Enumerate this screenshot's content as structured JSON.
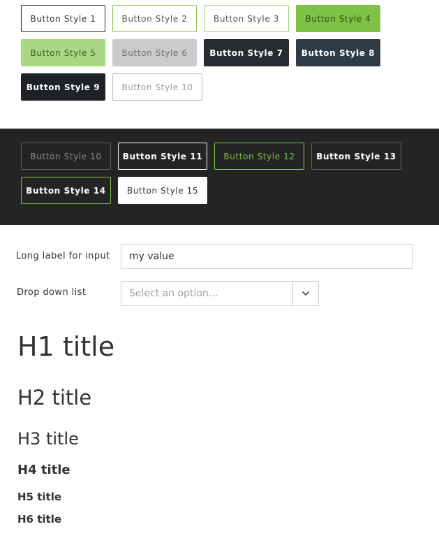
{
  "light_buttons": {
    "b1": "Button Style 1",
    "b2": "Button Style 2",
    "b3": "Button Style 3",
    "b4": "Button Style 4",
    "b5": "Button Style 5",
    "b6": "Button Style 6",
    "b7": "Button Style 7",
    "b8": "Button Style 8",
    "b9": "Button Style 9",
    "b10": "Button Style 10"
  },
  "dark_buttons": {
    "b10": "Button Style 10",
    "b11": "Button Style 11",
    "b12": "Button Style 12",
    "b13": "Button Style 13",
    "b14": "Button Style 14",
    "b15": "Button Style 15"
  },
  "form": {
    "input_label": "Long label for input",
    "input_value": "my value",
    "dropdown_label": "Drop down list",
    "dropdown_placeholder": "Select an option..."
  },
  "headings": {
    "h1": "H1 title",
    "h2": "H2 title",
    "h3": "H3 title",
    "h4": "H4 title",
    "h5": "H5 title",
    "h6": "H6 title"
  },
  "colors": {
    "accent_green": "#7dc245",
    "dark_band": "#242424",
    "dark_button": "#252b30"
  }
}
